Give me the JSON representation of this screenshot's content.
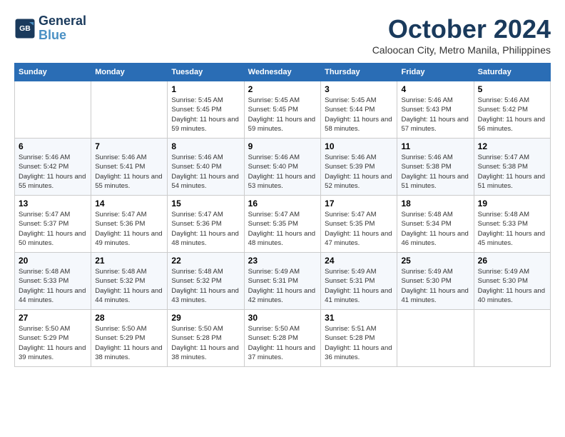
{
  "logo": {
    "line1": "General",
    "line2": "Blue"
  },
  "title": "October 2024",
  "subtitle": "Caloocan City, Metro Manila, Philippines",
  "weekdays": [
    "Sunday",
    "Monday",
    "Tuesday",
    "Wednesday",
    "Thursday",
    "Friday",
    "Saturday"
  ],
  "weeks": [
    [
      {
        "day": "",
        "info": ""
      },
      {
        "day": "",
        "info": ""
      },
      {
        "day": "1",
        "info": "Sunrise: 5:45 AM\nSunset: 5:45 PM\nDaylight: 11 hours and 59 minutes."
      },
      {
        "day": "2",
        "info": "Sunrise: 5:45 AM\nSunset: 5:45 PM\nDaylight: 11 hours and 59 minutes."
      },
      {
        "day": "3",
        "info": "Sunrise: 5:45 AM\nSunset: 5:44 PM\nDaylight: 11 hours and 58 minutes."
      },
      {
        "day": "4",
        "info": "Sunrise: 5:46 AM\nSunset: 5:43 PM\nDaylight: 11 hours and 57 minutes."
      },
      {
        "day": "5",
        "info": "Sunrise: 5:46 AM\nSunset: 5:42 PM\nDaylight: 11 hours and 56 minutes."
      }
    ],
    [
      {
        "day": "6",
        "info": "Sunrise: 5:46 AM\nSunset: 5:42 PM\nDaylight: 11 hours and 55 minutes."
      },
      {
        "day": "7",
        "info": "Sunrise: 5:46 AM\nSunset: 5:41 PM\nDaylight: 11 hours and 55 minutes."
      },
      {
        "day": "8",
        "info": "Sunrise: 5:46 AM\nSunset: 5:40 PM\nDaylight: 11 hours and 54 minutes."
      },
      {
        "day": "9",
        "info": "Sunrise: 5:46 AM\nSunset: 5:40 PM\nDaylight: 11 hours and 53 minutes."
      },
      {
        "day": "10",
        "info": "Sunrise: 5:46 AM\nSunset: 5:39 PM\nDaylight: 11 hours and 52 minutes."
      },
      {
        "day": "11",
        "info": "Sunrise: 5:46 AM\nSunset: 5:38 PM\nDaylight: 11 hours and 51 minutes."
      },
      {
        "day": "12",
        "info": "Sunrise: 5:47 AM\nSunset: 5:38 PM\nDaylight: 11 hours and 51 minutes."
      }
    ],
    [
      {
        "day": "13",
        "info": "Sunrise: 5:47 AM\nSunset: 5:37 PM\nDaylight: 11 hours and 50 minutes."
      },
      {
        "day": "14",
        "info": "Sunrise: 5:47 AM\nSunset: 5:36 PM\nDaylight: 11 hours and 49 minutes."
      },
      {
        "day": "15",
        "info": "Sunrise: 5:47 AM\nSunset: 5:36 PM\nDaylight: 11 hours and 48 minutes."
      },
      {
        "day": "16",
        "info": "Sunrise: 5:47 AM\nSunset: 5:35 PM\nDaylight: 11 hours and 48 minutes."
      },
      {
        "day": "17",
        "info": "Sunrise: 5:47 AM\nSunset: 5:35 PM\nDaylight: 11 hours and 47 minutes."
      },
      {
        "day": "18",
        "info": "Sunrise: 5:48 AM\nSunset: 5:34 PM\nDaylight: 11 hours and 46 minutes."
      },
      {
        "day": "19",
        "info": "Sunrise: 5:48 AM\nSunset: 5:33 PM\nDaylight: 11 hours and 45 minutes."
      }
    ],
    [
      {
        "day": "20",
        "info": "Sunrise: 5:48 AM\nSunset: 5:33 PM\nDaylight: 11 hours and 44 minutes."
      },
      {
        "day": "21",
        "info": "Sunrise: 5:48 AM\nSunset: 5:32 PM\nDaylight: 11 hours and 44 minutes."
      },
      {
        "day": "22",
        "info": "Sunrise: 5:48 AM\nSunset: 5:32 PM\nDaylight: 11 hours and 43 minutes."
      },
      {
        "day": "23",
        "info": "Sunrise: 5:49 AM\nSunset: 5:31 PM\nDaylight: 11 hours and 42 minutes."
      },
      {
        "day": "24",
        "info": "Sunrise: 5:49 AM\nSunset: 5:31 PM\nDaylight: 11 hours and 41 minutes."
      },
      {
        "day": "25",
        "info": "Sunrise: 5:49 AM\nSunset: 5:30 PM\nDaylight: 11 hours and 41 minutes."
      },
      {
        "day": "26",
        "info": "Sunrise: 5:49 AM\nSunset: 5:30 PM\nDaylight: 11 hours and 40 minutes."
      }
    ],
    [
      {
        "day": "27",
        "info": "Sunrise: 5:50 AM\nSunset: 5:29 PM\nDaylight: 11 hours and 39 minutes."
      },
      {
        "day": "28",
        "info": "Sunrise: 5:50 AM\nSunset: 5:29 PM\nDaylight: 11 hours and 38 minutes."
      },
      {
        "day": "29",
        "info": "Sunrise: 5:50 AM\nSunset: 5:28 PM\nDaylight: 11 hours and 38 minutes."
      },
      {
        "day": "30",
        "info": "Sunrise: 5:50 AM\nSunset: 5:28 PM\nDaylight: 11 hours and 37 minutes."
      },
      {
        "day": "31",
        "info": "Sunrise: 5:51 AM\nSunset: 5:28 PM\nDaylight: 11 hours and 36 minutes."
      },
      {
        "day": "",
        "info": ""
      },
      {
        "day": "",
        "info": ""
      }
    ]
  ]
}
